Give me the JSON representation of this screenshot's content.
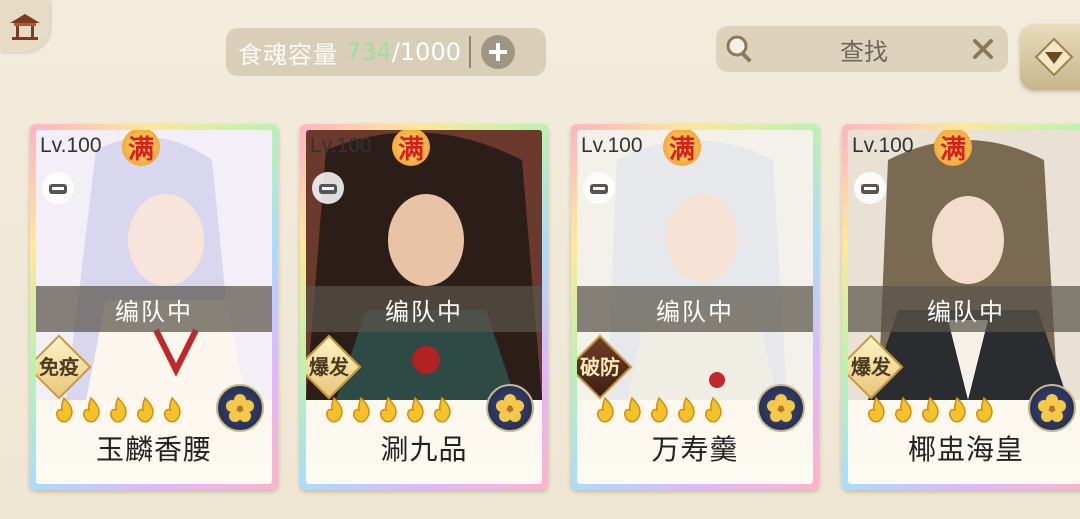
{
  "header": {
    "capacity_label": "食魂容量",
    "capacity_current": "734",
    "capacity_max": "/1000",
    "search_placeholder": "查找"
  },
  "cards": [
    {
      "level": "Lv.100",
      "full": "满",
      "status": "编队中",
      "tag": "免疫",
      "name": "玉麟香腰",
      "stars": 5,
      "hair": "#d9d6ef",
      "bg": "#f4eef6"
    },
    {
      "level": "Lv.100",
      "full": "满",
      "status": "编队中",
      "tag": "爆发",
      "name": "涮九品",
      "stars": 5,
      "hair": "#2b1d18",
      "bg": "#6b3a2c"
    },
    {
      "level": "Lv.100",
      "full": "满",
      "status": "编队中",
      "tag": "破防",
      "name": "万寿羹",
      "stars": 5,
      "hair": "#e6e8ec",
      "bg": "#f3f1ea"
    },
    {
      "level": "Lv.100",
      "full": "满",
      "status": "编队中",
      "tag": "爆发",
      "name": "椰盅海皇",
      "stars": 5,
      "hair": "#7a6a52",
      "bg": "#e9e2d4"
    }
  ],
  "colors": {
    "accent_green": "#9be0a0",
    "full_badge": "#d8201a"
  }
}
